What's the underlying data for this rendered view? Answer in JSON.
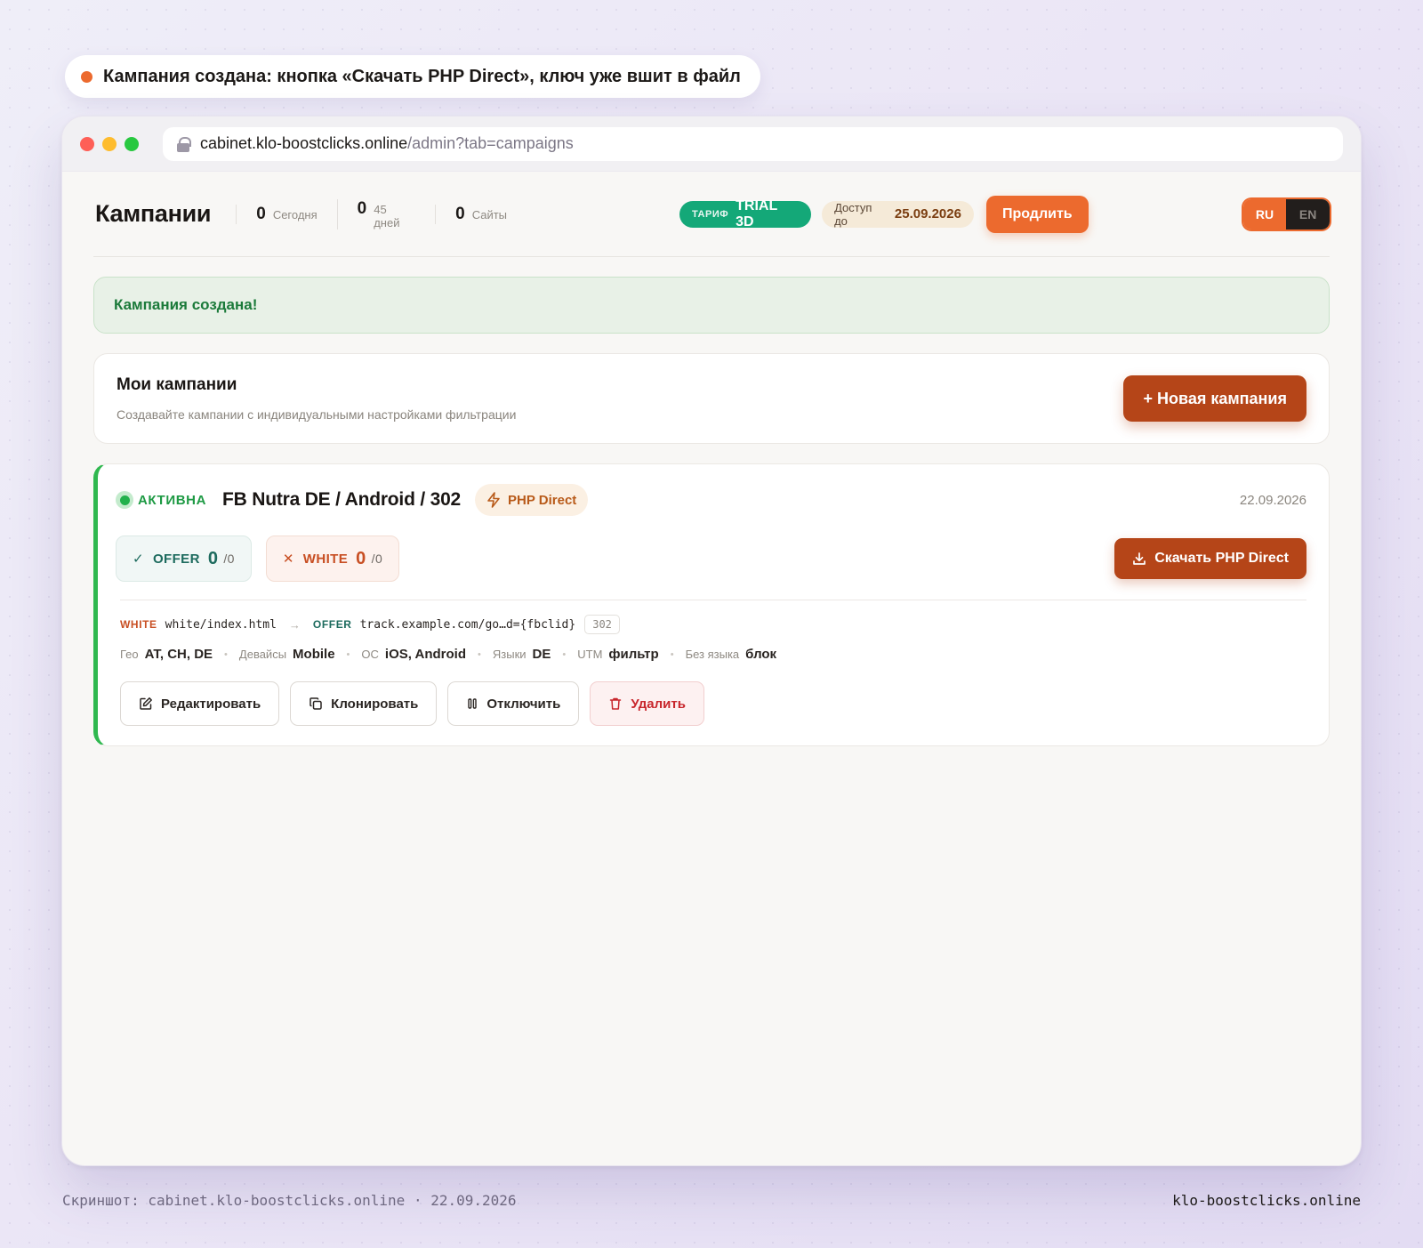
{
  "caption": {
    "text": "Кампания создана: кнопка «Скачать PHP Direct», ключ уже вшит в файл",
    "dot_color": "#ec6a2e"
  },
  "browser": {
    "url_host": "cabinet.klo-boostclicks.online",
    "url_path": "/admin?tab=campaigns"
  },
  "header": {
    "title": "Кампании",
    "stats": [
      {
        "value": "0",
        "label": "Сегодня"
      },
      {
        "value": "0",
        "label": "45 дней"
      },
      {
        "value": "0",
        "label": "Сайты"
      }
    ],
    "tariff_label": "ТАРИФ",
    "tariff_value": "TRIAL 3D",
    "access_label": "Доступ до",
    "access_date": "25.09.2026",
    "renew_button": "Продлить",
    "lang": {
      "active": "RU",
      "inactive": "EN"
    }
  },
  "alert": {
    "text": "Кампания создана!"
  },
  "campaigns_card": {
    "title": "Мои кампании",
    "subtitle": "Создавайте кампании с индивидуальными настройками фильтрации",
    "new_button": "+ Новая кампания"
  },
  "campaign": {
    "status": "АКТИВНА",
    "name": "FB Nutra DE / Android / 302",
    "type_badge": "PHP Direct",
    "date": "22.09.2026",
    "offer": {
      "label": "OFFER",
      "count": "0",
      "total": "/0"
    },
    "white": {
      "label": "WHITE",
      "count": "0",
      "total": "/0"
    },
    "download_button": "Скачать PHP Direct",
    "route": {
      "white_label": "WHITE",
      "white_path": "white/index.html",
      "offer_label": "OFFER",
      "offer_url": "track.example.com/go…d={fbclid}",
      "code": "302"
    },
    "meta": [
      {
        "label": "Гео",
        "value": "AT, CH, DE"
      },
      {
        "label": "Девайсы",
        "value": "Mobile"
      },
      {
        "label": "ОС",
        "value": "iOS, Android"
      },
      {
        "label": "Языки",
        "value": "DE"
      },
      {
        "label": "UTM",
        "value": "фильтр"
      },
      {
        "label": "Без языка",
        "value": "блок"
      }
    ],
    "actions": {
      "edit": "Редактировать",
      "clone": "Клонировать",
      "disable": "Отключить",
      "delete": "Удалить"
    }
  },
  "footer": {
    "left": "Скриншот: cabinet.klo-boostclicks.online · 22.09.2026",
    "right": "klo-boostclicks.online"
  },
  "colors": {
    "accent": "#ec6a2e",
    "primary_dark": "#b54518",
    "success": "#22b14c",
    "tariff": "#14a878",
    "danger": "#c8262c"
  }
}
